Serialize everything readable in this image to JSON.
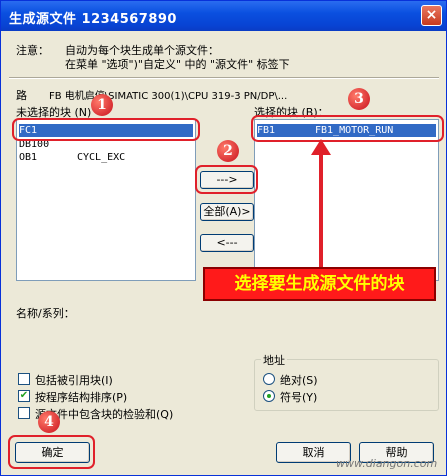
{
  "window": {
    "title": "生成源文件  1234567890",
    "close_label": "×"
  },
  "notice": {
    "label": "注意：",
    "line1": "自动为每个块生成单个源文件：",
    "line2": "在菜单 \"选项\")\"自定义\" 中的 \"源文件\" 标签下"
  },
  "path": {
    "label": "路",
    "value": "FB 电机启停\\SIMATIC 300(1)\\CPU 319-3 PN/DP\\..."
  },
  "unselected": {
    "label": "未选择的块 (N)",
    "items": [
      {
        "name": "FC1",
        "desc": ""
      },
      {
        "name": "DB100",
        "desc": ""
      },
      {
        "name": "OB1",
        "desc": "CYCL_EXC"
      }
    ]
  },
  "selected": {
    "label": "选择的块 (B)：",
    "items": [
      {
        "name": "FB1",
        "desc": "FB1_MOTOR_RUN"
      }
    ]
  },
  "buttons": {
    "add": "--->",
    "add_all": "全部(A)>",
    "remove": "<---",
    "ok": "确定",
    "cancel": "取消",
    "help": "帮助"
  },
  "name_family": {
    "label": "名称/系列："
  },
  "options": {
    "include_refs": {
      "label": "包括被引用块(I)",
      "checked": false
    },
    "sort_by_structure": {
      "label": "按程序结构排序(P)",
      "checked": true
    },
    "include_checksum": {
      "label": "源文件中包含块的检验和(Q)",
      "checked": false
    }
  },
  "address": {
    "label": "地址",
    "absolute": {
      "label": "绝对(S)",
      "selected": false
    },
    "symbolic": {
      "label": "符号(Y)",
      "selected": true
    }
  },
  "annotations": {
    "badge1": "1",
    "badge2": "2",
    "badge3": "3",
    "badge4": "4",
    "callout": "选择要生成源文件的块",
    "watermark": "www.diangon.com"
  },
  "colors": {
    "selection": "#316ac5",
    "annotation_red": "#e0202a",
    "callout_text": "#ffff00"
  }
}
